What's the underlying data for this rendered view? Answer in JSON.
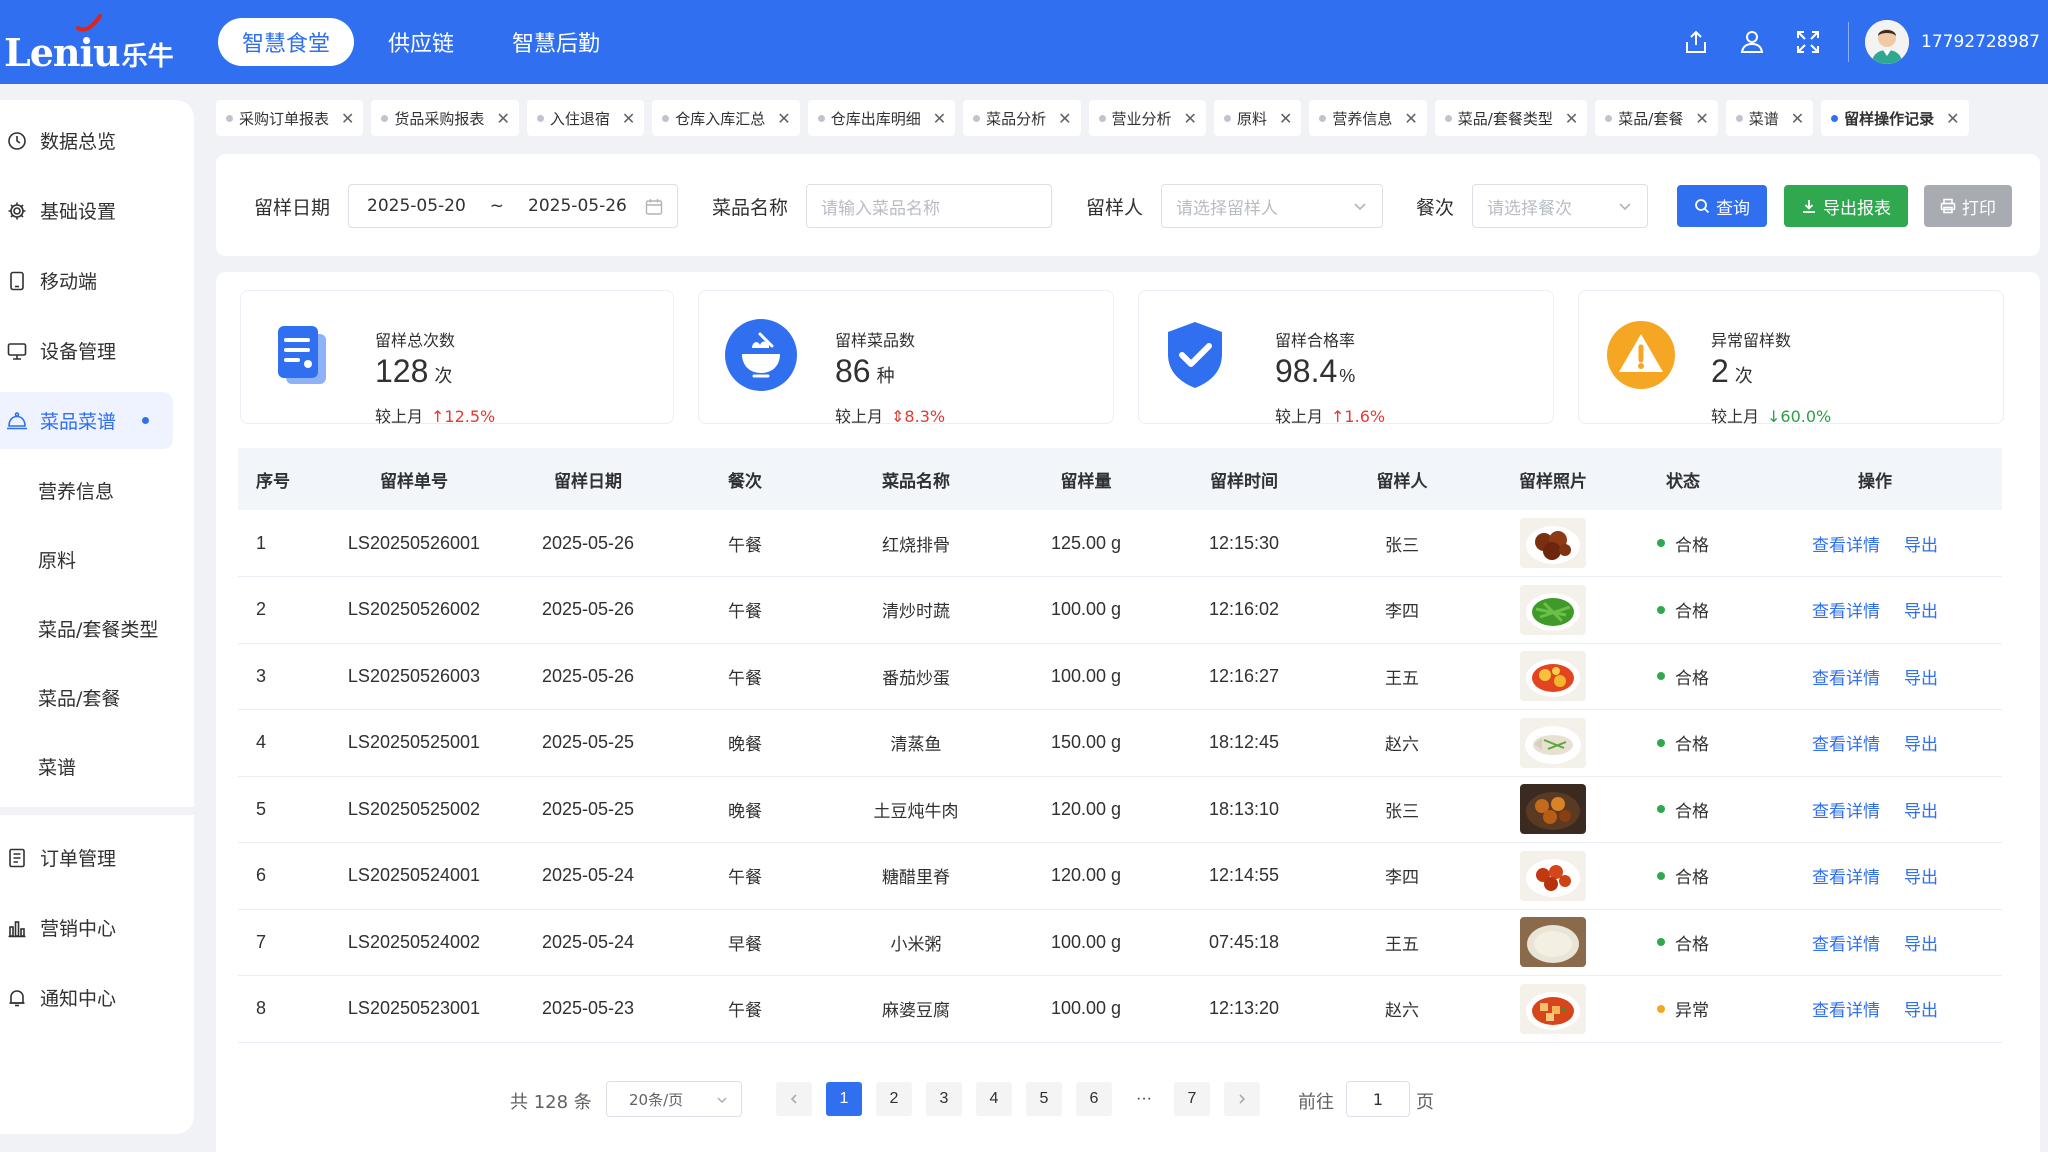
{
  "brand": {
    "logo_en": "Leniu",
    "logo_cn": "乐牛"
  },
  "topnav": [
    "智慧食堂",
    "供应链",
    "智慧后勤"
  ],
  "user": {
    "phone": "17792728987"
  },
  "sidebar": {
    "items": [
      "数据总览",
      "基础设置",
      "移动端",
      "设备管理",
      "菜品菜谱"
    ],
    "subitems": [
      "营养信息",
      "原料",
      "菜品/套餐类型",
      "菜品/套餐",
      "菜谱"
    ],
    "bottom_items": [
      "订单管理",
      "营销中心",
      "通知中心"
    ]
  },
  "tabs": [
    "采购订单报表",
    "货品采购报表",
    "入住退宿",
    "仓库入库汇总",
    "仓库出库明细",
    "菜品分析",
    "营业分析",
    "原料",
    "营养信息",
    "菜品/套餐类型",
    "菜品/套餐",
    "菜谱",
    "留样操作记录"
  ],
  "filters": {
    "date_label": "留样日期",
    "date_start": "2025-05-20",
    "date_sep": "~",
    "date_end": "2025-05-26",
    "dish_label": "菜品名称",
    "dish_placeholder": "请输入菜品名称",
    "person_label": "留样人",
    "person_placeholder": "请选择留样人",
    "meal_label": "餐次",
    "meal_placeholder": "请选择餐次",
    "query_btn": "查询",
    "export_btn": "导出报表",
    "print_btn": "打印"
  },
  "stats": [
    {
      "title": "留样总次数",
      "value": "128",
      "unit": "次",
      "cmp_label": "较上月",
      "change": "↑12.5%",
      "trend": "up"
    },
    {
      "title": "留样菜品数",
      "value": "86",
      "unit": "种",
      "cmp_label": "较上月",
      "change": "⇕8.3%",
      "trend": "up"
    },
    {
      "title": "留样合格率",
      "value": "98.4",
      "unit": "%",
      "cmp_label": "较上月",
      "change": "↑1.6%",
      "trend": "up"
    },
    {
      "title": "异常留样数",
      "value": "2",
      "unit": "次",
      "cmp_label": "较上月",
      "change": "↓60.0%",
      "trend": "down"
    }
  ],
  "table": {
    "headers": [
      "序号",
      "留样单号",
      "留样日期",
      "餐次",
      "菜品名称",
      "留样量",
      "留样时间",
      "留样人",
      "留样照片",
      "状态",
      "操作"
    ],
    "rows": [
      {
        "no": "1",
        "id": "LS20250526001",
        "date": "2025-05-26",
        "meal": "午餐",
        "dish": "红烧排骨",
        "qty": "125.00 g",
        "time": "12:15:30",
        "person": "张三",
        "photo": "braised-ribs",
        "status": "合格"
      },
      {
        "no": "2",
        "id": "LS20250526002",
        "date": "2025-05-26",
        "meal": "午餐",
        "dish": "清炒时蔬",
        "qty": "100.00 g",
        "time": "12:16:02",
        "person": "李四",
        "photo": "stir-fried-greens",
        "status": "合格"
      },
      {
        "no": "3",
        "id": "LS20250526003",
        "date": "2025-05-26",
        "meal": "午餐",
        "dish": "番茄炒蛋",
        "qty": "100.00 g",
        "time": "12:16:27",
        "person": "王五",
        "photo": "tomato-egg",
        "status": "合格"
      },
      {
        "no": "4",
        "id": "LS20250525001",
        "date": "2025-05-25",
        "meal": "晚餐",
        "dish": "清蒸鱼",
        "qty": "150.00 g",
        "time": "18:12:45",
        "person": "赵六",
        "photo": "steamed-fish",
        "status": "合格"
      },
      {
        "no": "5",
        "id": "LS20250525002",
        "date": "2025-05-25",
        "meal": "晚餐",
        "dish": "土豆炖牛肉",
        "qty": "120.00 g",
        "time": "18:13:10",
        "person": "张三",
        "photo": "beef-potato",
        "status": "合格"
      },
      {
        "no": "6",
        "id": "LS20250524001",
        "date": "2025-05-24",
        "meal": "午餐",
        "dish": "糖醋里脊",
        "qty": "120.00 g",
        "time": "12:14:55",
        "person": "李四",
        "photo": "sweet-sour-pork",
        "status": "合格"
      },
      {
        "no": "7",
        "id": "LS20250524002",
        "date": "2025-05-24",
        "meal": "早餐",
        "dish": "小米粥",
        "qty": "100.00 g",
        "time": "07:45:18",
        "person": "王五",
        "photo": "millet-porridge",
        "status": "合格"
      },
      {
        "no": "8",
        "id": "LS20250523001",
        "date": "2025-05-23",
        "meal": "午餐",
        "dish": "麻婆豆腐",
        "qty": "100.00 g",
        "time": "12:13:20",
        "person": "赵六",
        "photo": "mapo-tofu",
        "status": "异常"
      }
    ],
    "action_detail": "查看详情",
    "action_export": "导出"
  },
  "pagination": {
    "total": "共 128 条",
    "page_size": "20条/页",
    "pages": [
      "1",
      "2",
      "3",
      "4",
      "5",
      "6",
      "···",
      "7"
    ],
    "current": "1",
    "goto_label": "前往",
    "goto_value": "1",
    "goto_suffix": "页"
  },
  "colors": {
    "primary": "#2f6ff0",
    "success": "#2fa84f",
    "warning": "#f5a623",
    "disabled": "#a8abb2",
    "up": "#e53935",
    "down": "#2e9e46"
  }
}
